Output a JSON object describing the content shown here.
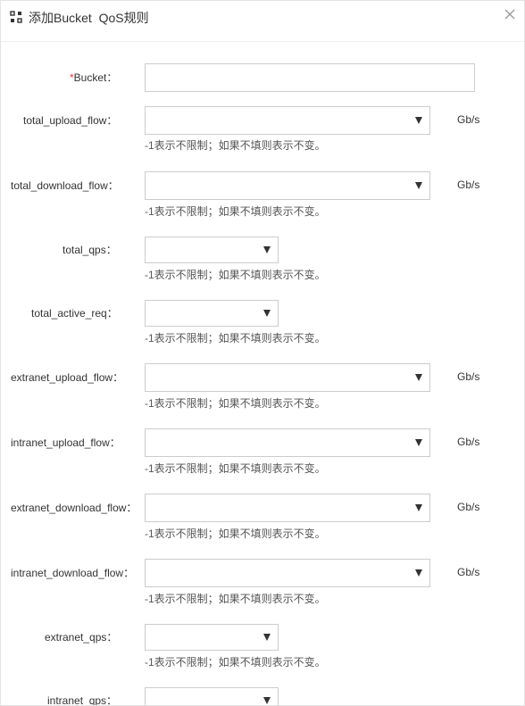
{
  "dialog": {
    "title": "添加Bucket  QoS规则",
    "header_icon": "grid-settings-icon",
    "close_icon": "close-icon"
  },
  "form": {
    "bucket": {
      "required_mark": "*",
      "label": "Bucket：",
      "value": ""
    },
    "hint_text": "-1表示不限制；如果不填则表示不变。",
    "unit": "Gb/s",
    "fields": [
      {
        "label": "total_upload_flow：",
        "value": "",
        "unit": "Gb/s"
      },
      {
        "label": "total_download_flow：",
        "value": "",
        "unit": "Gb/s"
      },
      {
        "label": "total_qps：",
        "value": ""
      },
      {
        "label": "total_active_req：",
        "value": ""
      },
      {
        "label": "extranet_upload_flow：",
        "value": "",
        "unit": "Gb/s"
      },
      {
        "label": "intranet_upload_flow：",
        "value": "",
        "unit": "Gb/s"
      },
      {
        "label": "extranet_download_flow：",
        "value": "",
        "unit": "Gb/s"
      },
      {
        "label": "intranet_download_flow：",
        "value": "",
        "unit": "Gb/s"
      },
      {
        "label": "extranet_qps：",
        "value": ""
      },
      {
        "label": "intranet_qps：",
        "value": ""
      }
    ]
  }
}
